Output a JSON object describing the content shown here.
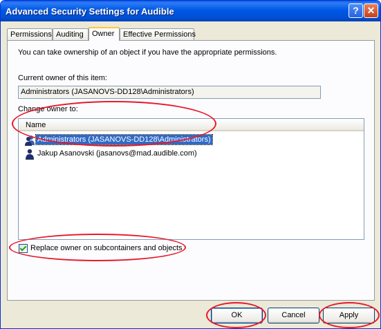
{
  "window": {
    "title": "Advanced Security Settings for Audible",
    "help_glyph": "?",
    "close_glyph": "✕"
  },
  "tabs": [
    {
      "label": "Permissions"
    },
    {
      "label": "Auditing"
    },
    {
      "label": "Owner",
      "active": true
    },
    {
      "label": "Effective Permissions"
    }
  ],
  "owner_panel": {
    "intro_text": "You can take ownership of an object if you have the appropriate permissions.",
    "current_owner_label": "Current owner of this item:",
    "current_owner_value": "Administrators (JASANOVS-DD128\\Administrators)",
    "change_owner_label": "Change owner to:",
    "list_header": "Name",
    "list_items": [
      {
        "label": "Administrators (JASANOVS-DD128\\Administrators)",
        "icon": "group-icon",
        "selected": true
      },
      {
        "label": "Jakup Asanovski (jasanovs@mad.audible.com)",
        "icon": "user-icon",
        "selected": false
      }
    ],
    "replace_checkbox_label": "Replace owner on subcontainers and objects",
    "replace_checked": true
  },
  "buttons": {
    "ok": "OK",
    "cancel": "Cancel",
    "apply": "Apply"
  },
  "colors": {
    "annotation_red": "#e8182a",
    "selection_blue": "#316ac5",
    "titlebar_blue": "#0058e6"
  }
}
